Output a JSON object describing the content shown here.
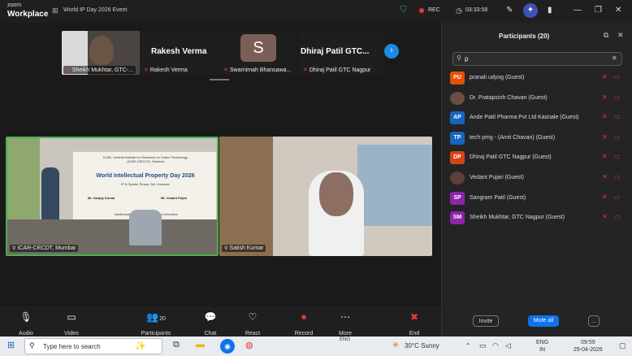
{
  "app": {
    "logo_line1": "zoom",
    "logo_line2": "Workplace",
    "window_title": "World IP Day 2026 Event"
  },
  "titlebar": {
    "rec_label": "REC",
    "timer": "03:33:58"
  },
  "top_strip": [
    {
      "name": "Sheikh Mukhtar, GTC-...",
      "type": "video"
    },
    {
      "name": "Rakesh Verma",
      "display": "Rakesh Verma",
      "type": "name"
    },
    {
      "name": "Swarnimah Bhansawa...",
      "initial": "S",
      "type": "avatar"
    },
    {
      "name": "Dhiraj Patil GTC Nagpur",
      "display": "Dhiraj Patil GTC...",
      "type": "name"
    }
  ],
  "main_tiles": [
    {
      "name": "ICAR-CRCDT, Mumbai"
    },
    {
      "name": "Satish Kumar"
    }
  ],
  "banner": {
    "heading_line1": "ICAR- Central Institute for Research on Cotton Technology",
    "heading_line2": "(ICAR-CIRCOT), Mumbai",
    "title": "World Intellectual Property Day 2026",
    "subtitle": "IP & Sports: Ready, Set, Innovate",
    "speaker1": "Mr. Sanjay Kumar",
    "speaker2": "Mr. Vedant Pujari",
    "topic": "Intellectual Property & the Sports Innovation"
  },
  "participants": {
    "title": "Participants (20)",
    "search_value": "p",
    "list": [
      {
        "initials": "PU",
        "name": "pranali udyog (Guest)",
        "color": "#e65100"
      },
      {
        "initials": "",
        "name": "Dr. Pratapsinh Chavan (Guest)",
        "color": "#6d4c41"
      },
      {
        "initials": "AP",
        "name": "Ande Patil Pharma Pvt Ltd Kasnale (Guest)",
        "color": "#1565c0"
      },
      {
        "initials": "TP",
        "name": "tech pmg - (Amit Chavan) (Guest)",
        "color": "#1565c0"
      },
      {
        "initials": "DP",
        "name": "Dhiraj Patil GTC Nagpur (Guest)",
        "color": "#d84315"
      },
      {
        "initials": "",
        "name": "Vedant Pujari (Guest)",
        "color": "#5d4037"
      },
      {
        "initials": "SP",
        "name": "Sangram Patil (Guest)",
        "color": "#8e24aa"
      },
      {
        "initials": "SM",
        "name": "Sheikh Mukhtar, GTC Nagpur (Guest)",
        "color": "#8e24aa"
      }
    ],
    "invite_label": "Invite",
    "mute_all_label": "Mute all",
    "more_label": "..."
  },
  "toolbar": [
    {
      "label": "Audio",
      "icon": "mic-icon",
      "glyph": "🎙"
    },
    {
      "label": "Video",
      "icon": "video-icon",
      "glyph": "▭"
    },
    {
      "label": "Participants",
      "icon": "participants-icon",
      "glyph": "👥",
      "count": "20"
    },
    {
      "label": "Chat",
      "icon": "chat-icon",
      "glyph": "💬"
    },
    {
      "label": "React",
      "icon": "react-icon",
      "glyph": "♡"
    },
    {
      "label": "Record",
      "icon": "record-icon",
      "glyph": "⏺"
    },
    {
      "label": "More",
      "icon": "more-icon",
      "glyph": "⋯"
    },
    {
      "label": "End",
      "icon": "end-icon",
      "glyph": "✖"
    }
  ],
  "taskbar": {
    "search_placeholder": "Type here to search",
    "weather": "30°C  Sunny",
    "lang_line1": "ENG",
    "lang_line2": "IN",
    "time": "09:59",
    "date": "29-04-2026"
  }
}
